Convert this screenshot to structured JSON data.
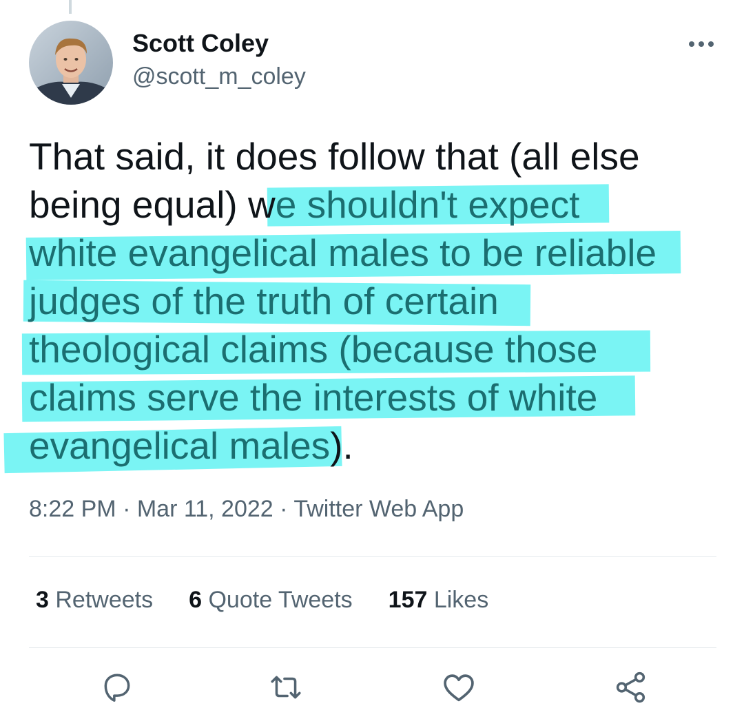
{
  "author": {
    "display_name": "Scott Coley",
    "handle": "@scott_m_coley"
  },
  "tweet": {
    "lines": [
      [
        {
          "text": "That said, it does follow that (all else",
          "highlighted": false
        }
      ],
      [
        {
          "text": "being equal) w",
          "highlighted": false
        },
        {
          "text": "e shouldn't expect",
          "highlighted": true
        }
      ],
      [
        {
          "text": "white evangelical males to be reliable",
          "highlighted": true
        }
      ],
      [
        {
          "text": "judges of the truth of certain",
          "highlighted": true
        }
      ],
      [
        {
          "text": "theological claims (because those",
          "highlighted": true
        }
      ],
      [
        {
          "text": "claims serve the interests of white",
          "highlighted": true
        }
      ],
      [
        {
          "text": "evangelical males",
          "highlighted": true
        },
        {
          "text": ").",
          "highlighted": false
        }
      ]
    ],
    "highlight_color": "#46f0f0"
  },
  "meta": {
    "time": "8:22 PM",
    "separator": "·",
    "date": "Mar 11, 2022",
    "source": "Twitter Web App"
  },
  "stats": [
    {
      "count": "3",
      "label": "Retweets"
    },
    {
      "count": "6",
      "label": "Quote Tweets"
    },
    {
      "count": "157",
      "label": "Likes"
    }
  ],
  "actions": [
    {
      "icon": "reply-icon"
    },
    {
      "icon": "retweet-icon"
    },
    {
      "icon": "like-icon"
    },
    {
      "icon": "share-icon"
    }
  ],
  "icons": {
    "more": "more-horizontal-icon"
  },
  "colors": {
    "text": "#0f1419",
    "secondary": "#536471",
    "highlighted_text": "#1b6e70"
  }
}
